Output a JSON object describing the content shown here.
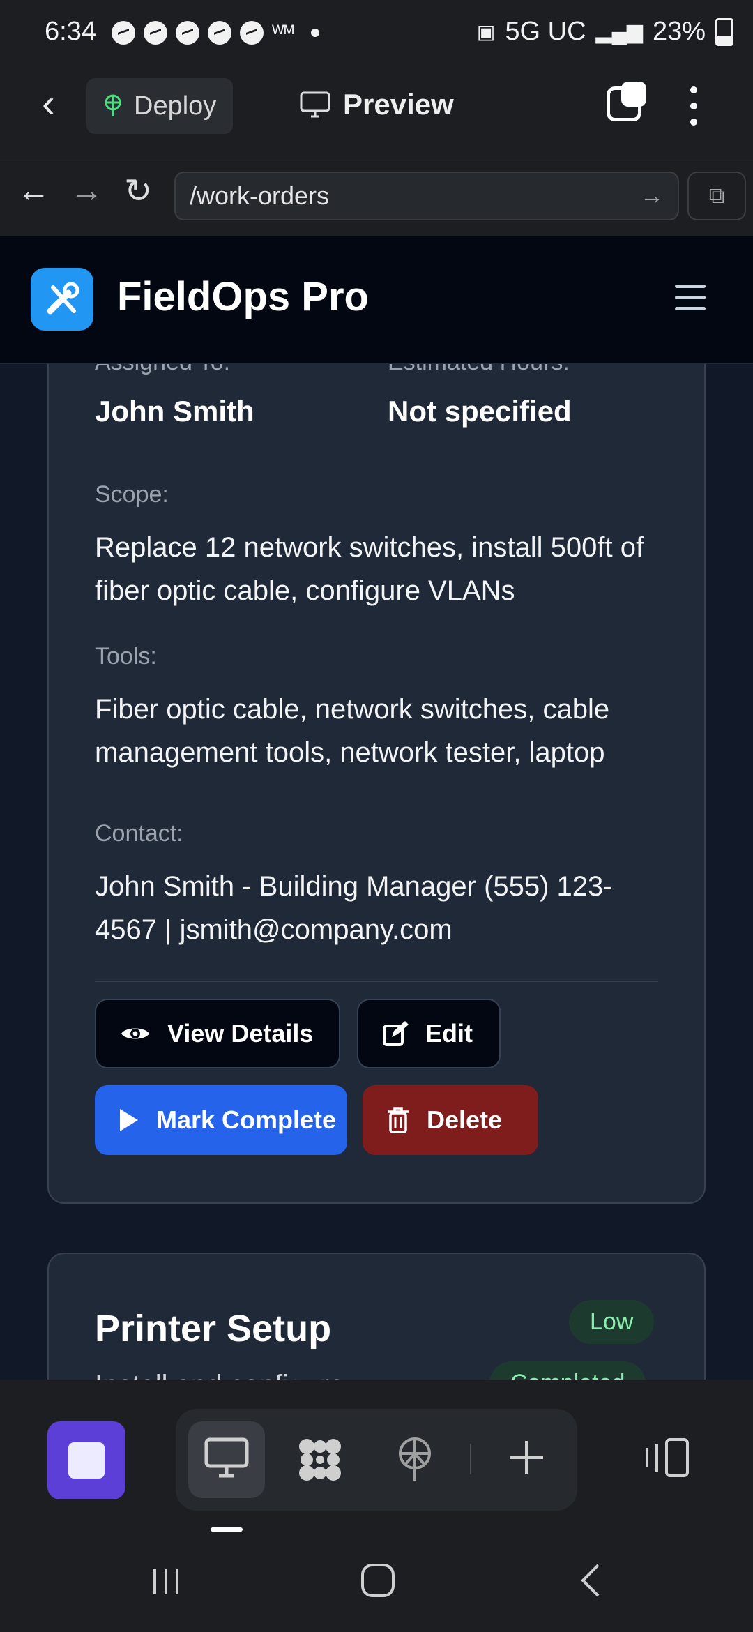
{
  "status_bar": {
    "time": "6:34",
    "network": "5G UC",
    "battery": "23%"
  },
  "toolbar": {
    "deploy_label": "Deploy",
    "preview_label": "Preview"
  },
  "browser": {
    "url": "/work-orders"
  },
  "app": {
    "name": "FieldOps Pro",
    "accent": "#2196f3"
  },
  "work_order": {
    "assigned_label": "Assigned To:",
    "assigned_value": "John Smith",
    "hours_label": "Estimated Hours:",
    "hours_value": "Not specified",
    "scope_label": "Scope:",
    "scope_value": "Replace 12 network switches, install 500ft of fiber optic cable, configure VLANs",
    "tools_label": "Tools:",
    "tools_value": "Fiber optic cable, network switches, cable management tools, network tester, laptop",
    "contact_label": "Contact:",
    "contact_value": "John Smith - Building Manager (555) 123-4567 | jsmith@company.com",
    "actions": {
      "view": "View Details",
      "edit": "Edit",
      "complete": "Mark Complete",
      "delete": "Delete"
    }
  },
  "next_order": {
    "title": "Printer Setup",
    "priority": "Low",
    "status": "Completed",
    "subtitle": "Install and configure"
  },
  "colors": {
    "blue_button": "#2563eb",
    "red_button": "#7f1d1d",
    "card": "#1f2937",
    "low_badge": "#86efac"
  }
}
